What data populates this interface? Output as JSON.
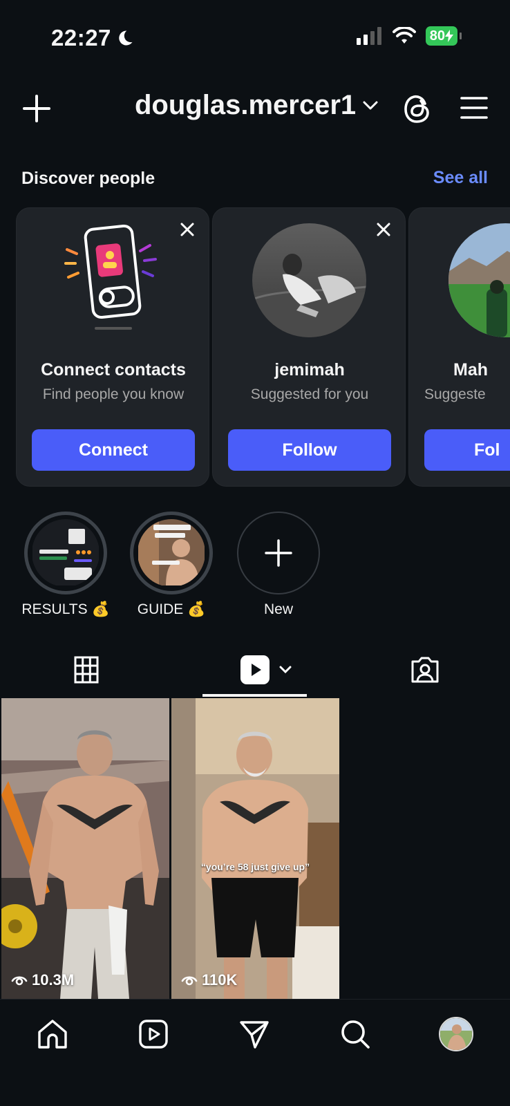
{
  "status_bar": {
    "time": "22:27",
    "battery": "80"
  },
  "header": {
    "username": "douglas.mercer1"
  },
  "discover": {
    "title": "Discover people",
    "see_all": "See all",
    "cards": [
      {
        "name": "Connect contacts",
        "subtitle": "Find people you know",
        "button": "Connect"
      },
      {
        "name": "jemimah",
        "subtitle": "Suggested for you",
        "button": "Follow"
      },
      {
        "name": "Mah",
        "subtitle": "Suggeste",
        "button": "Fol"
      }
    ]
  },
  "highlights": [
    {
      "label": "RESULTS 💰"
    },
    {
      "label": "GUIDE 💰"
    },
    {
      "label": "New"
    }
  ],
  "reels": [
    {
      "views": "10.3M",
      "caption": ""
    },
    {
      "views": "110K",
      "caption": "“you’re 58 just give up”"
    }
  ],
  "colors": {
    "accent": "#4a5df9",
    "link": "#6b8cff",
    "background": "#0c1014",
    "card": "#1f2328"
  }
}
